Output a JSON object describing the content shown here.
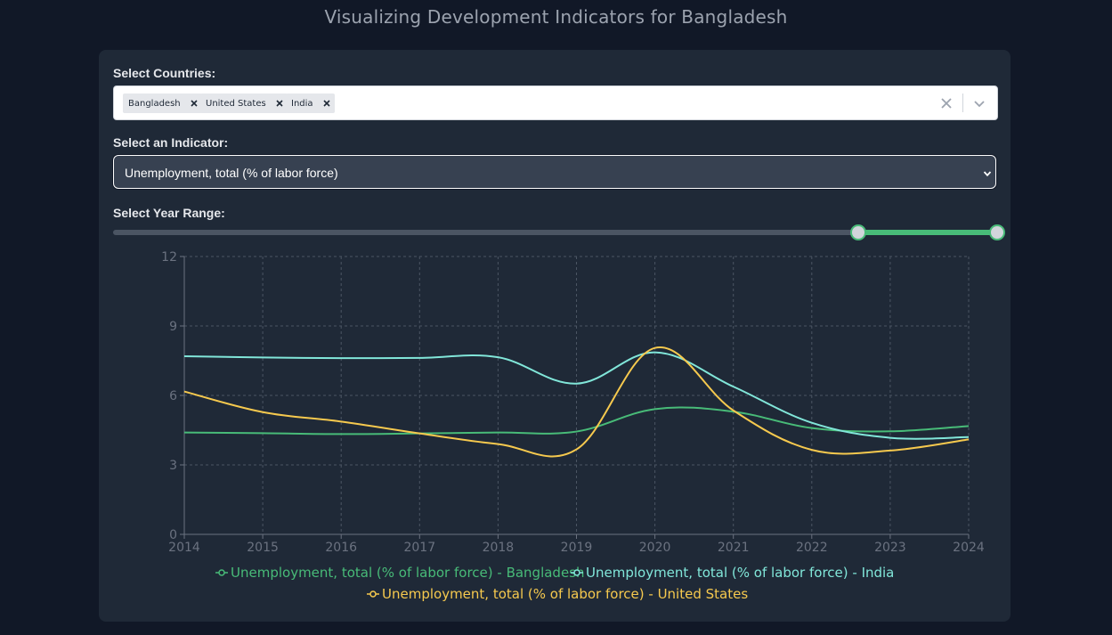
{
  "header": {
    "title": "Visualizing Development Indicators for Bangladesh"
  },
  "controls": {
    "countries_label": "Select Countries:",
    "selected_countries": [
      "Bangladesh",
      "United States",
      "India"
    ],
    "indicator_label": "Select an Indicator:",
    "indicator_value": "Unemployment, total (% of labor force)",
    "year_range_label": "Select Year Range:",
    "year_range": {
      "min": 1991,
      "max": 2024,
      "start": 2014,
      "end": 2024
    }
  },
  "icons": {
    "chip_remove": "close-icon",
    "clear_all": "close-icon",
    "dropdown": "chevron-down-icon"
  },
  "colors": {
    "background": "#111827",
    "card": "#1f2937",
    "accent": "#48bb78",
    "bangladesh": "#48bb78",
    "india": "#81e6d9",
    "united_states": "#f6c94e"
  },
  "chart_data": {
    "type": "line",
    "x": [
      2014,
      2015,
      2016,
      2017,
      2018,
      2019,
      2020,
      2021,
      2022,
      2023,
      2024
    ],
    "xlim": [
      2014,
      2024
    ],
    "ylim": [
      0,
      12
    ],
    "yticks": [
      0,
      3,
      6,
      9,
      12
    ],
    "grid": true,
    "legend_position": "bottom",
    "series": [
      {
        "name": "Unemployment, total (% of labor force) - Bangladesh",
        "color": "#48bb78",
        "values": [
          4.4,
          4.37,
          4.33,
          4.36,
          4.4,
          4.44,
          5.41,
          5.3,
          4.59,
          4.45,
          4.68
        ]
      },
      {
        "name": "Unemployment, total (% of labor force) - India",
        "color": "#81e6d9",
        "values": [
          7.69,
          7.64,
          7.61,
          7.62,
          7.65,
          6.51,
          7.86,
          6.38,
          4.82,
          4.17,
          4.2
        ]
      },
      {
        "name": "Unemployment, total (% of labor force) - United States",
        "color": "#f6c94e",
        "values": [
          6.17,
          5.28,
          4.87,
          4.36,
          3.9,
          3.67,
          8.05,
          5.35,
          3.65,
          3.62,
          4.1
        ]
      }
    ]
  }
}
